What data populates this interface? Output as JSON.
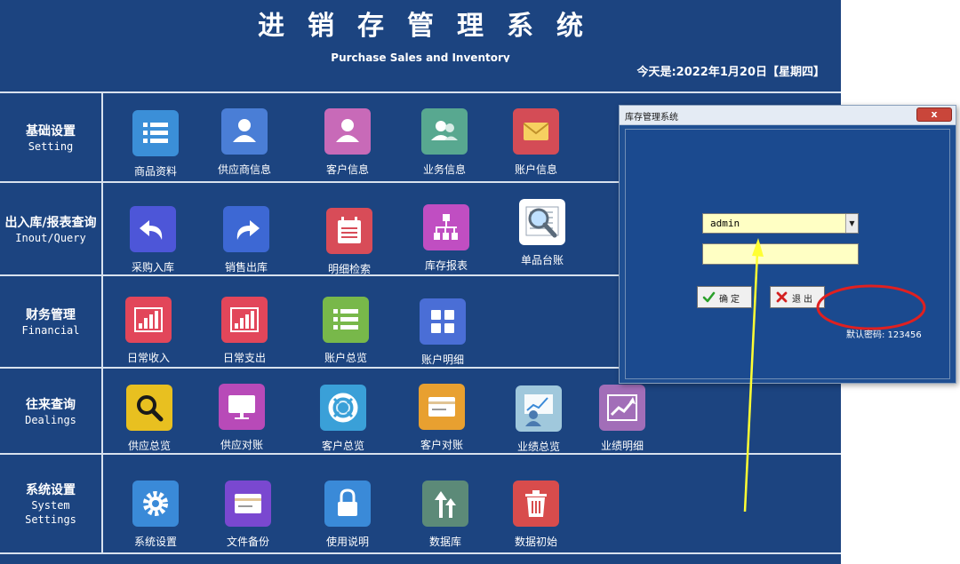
{
  "app": {
    "title": "进销存管理系统",
    "subtitle": "Purchase Sales and Inventory",
    "date_line": "今天是:2022年1月20日【星期四】"
  },
  "sections": [
    {
      "zh": "基础设置",
      "en": "Setting"
    },
    {
      "zh": "出入库/报表查询",
      "en": "Inout/Query"
    },
    {
      "zh": "财务管理",
      "en": "Financial"
    },
    {
      "zh": "往来查询",
      "en": "Dealings"
    },
    {
      "zh": "系统设置",
      "en": "System",
      "en2": "Settings"
    }
  ],
  "items": {
    "setting": [
      "商品资料",
      "供应商信息",
      "客户信息",
      "业务信息",
      "账户信息"
    ],
    "query": [
      "采购入库",
      "销售出库",
      "明细检索",
      "库存报表",
      "单品台账"
    ],
    "financial": [
      "日常收入",
      "日常支出",
      "账户总览",
      "账户明细"
    ],
    "dealings": [
      "供应总览",
      "供应对账",
      "客户总览",
      "客户对账",
      "业绩总览",
      "业绩明细"
    ],
    "system": [
      "系统设置",
      "文件备份",
      "使用说明",
      "数据库",
      "数据初始"
    ]
  },
  "icons": {
    "setting": [
      "list-icon",
      "person-icon",
      "person-icon",
      "group-icon",
      "envelope-icon"
    ],
    "query": [
      "undo-arrow-icon",
      "redo-arrow-icon",
      "calendar-list-icon",
      "org-chart-icon",
      "magnifier-document-icon"
    ],
    "financial": [
      "bar-chart-icon",
      "bar-chart-icon",
      "list-icon",
      "grid-icon"
    ],
    "dealings": [
      "search-icon",
      "monitor-icon",
      "lifebuoy-icon",
      "card-icon",
      "chart-person-icon",
      "trend-chart-icon"
    ],
    "system": [
      "gear-icon",
      "card-icon",
      "lock-icon",
      "upload-arrows-icon",
      "trash-icon"
    ]
  },
  "tile_colors": {
    "setting": [
      "#3b8fd8",
      "#4a7ed6",
      "#c86ab8",
      "#58a890",
      "#d44c56"
    ],
    "query": [
      "#4d56d8",
      "#3d68d4",
      "#d84c58",
      "#c04ec2",
      "#ffffff"
    ],
    "financial": [
      "#e2465a",
      "#e2465a",
      "#78b84a",
      "#4a6ed6"
    ],
    "dealings": [
      "#e8c020",
      "#b84ab8",
      "#3aa0d8",
      "#e8a030",
      "#a0c8dc",
      "#a26eb8"
    ],
    "system": [
      "#3a8ad8",
      "#7a48d0",
      "#3a8ad8",
      "#5c8a78",
      "#d84c4c"
    ]
  },
  "dialog": {
    "title": "库存管理系统",
    "close_label": "x",
    "user_value": "admin",
    "password_value": "",
    "ok_label": "确定",
    "exit_label": "退出",
    "default_password": "默认密码: 123456"
  },
  "colors": {
    "background": "#1c4480",
    "divider": "#d8e2ee",
    "input_bg": "#ffffc4",
    "annotation_circle": "#e02020",
    "annotation_arrow": "#ffff33"
  }
}
